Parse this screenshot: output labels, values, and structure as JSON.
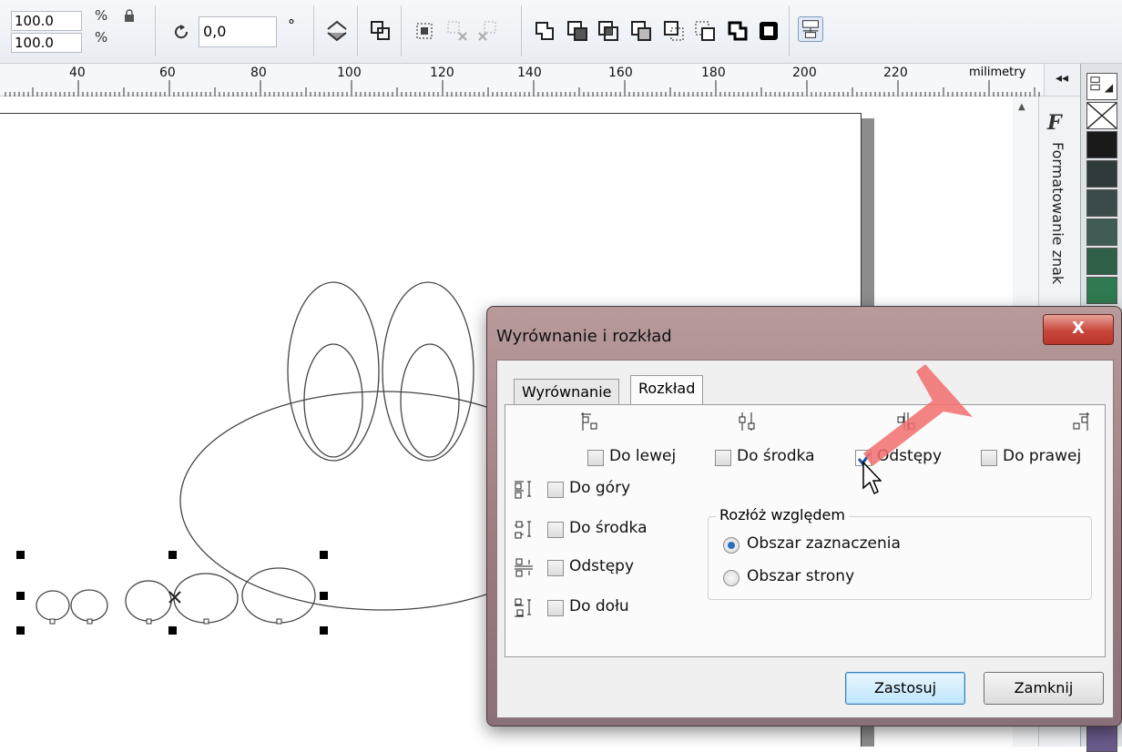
{
  "toolbar": {
    "scale_x": "100.0",
    "scale_y": "100.0",
    "pct_symbol": "%",
    "rotation_value": "0,0",
    "degree_symbol": "°"
  },
  "ruler": {
    "labels": [
      "40",
      "60",
      "80",
      "100",
      "120",
      "140",
      "160",
      "180",
      "200",
      "220"
    ],
    "unit": "milimetry"
  },
  "docker": {
    "collapse_glyph": "◂◂",
    "title": "Formatowanie znak"
  },
  "dialog": {
    "title": "Wyrównanie i rozkład",
    "close_label": "X",
    "tabs": [
      {
        "label": "Wyrównanie"
      },
      {
        "label": "Rozkład"
      }
    ],
    "horizontal_options": [
      {
        "label": "Do lewej",
        "checked": false
      },
      {
        "label": "Do środka",
        "checked": false
      },
      {
        "label": "Odstępy",
        "checked": true
      },
      {
        "label": "Do prawej",
        "checked": false
      }
    ],
    "vertical_options": [
      {
        "label": "Do góry",
        "checked": false
      },
      {
        "label": "Do środka",
        "checked": false
      },
      {
        "label": "Odstępy",
        "checked": false
      },
      {
        "label": "Do dołu",
        "checked": false
      }
    ],
    "distribute_group": {
      "title": "Rozłóż względem",
      "options": [
        {
          "label": "Obszar zaznaczenia",
          "selected": true
        },
        {
          "label": "Obszar strony",
          "selected": false
        }
      ]
    },
    "apply_label": "Zastosuj",
    "close_button_label": "Zamknij"
  },
  "colors": {
    "accent": "#2a6fbf",
    "close_red": "#c8463a",
    "annotation_arrow": "#f26d6d"
  }
}
